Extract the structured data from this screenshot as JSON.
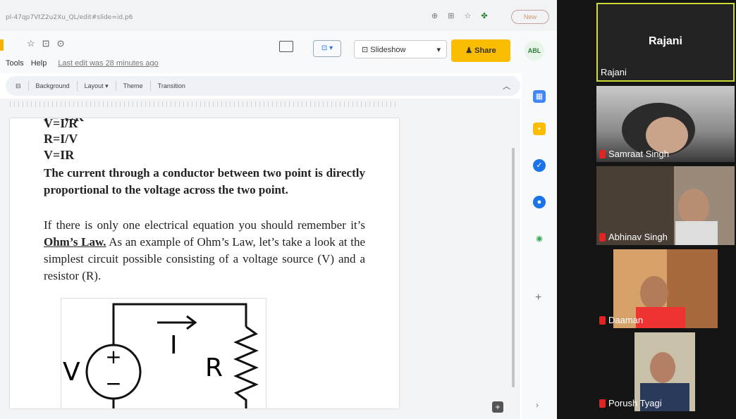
{
  "browser": {
    "url": "pl-47qp7VtZ2u2Xu_QL/edit#slide=id.p6",
    "new_label": "New",
    "docs_menu": [
      "Tools",
      "Help"
    ],
    "last_edit": "Last edit was 28 minutes ago",
    "slideshow_label": "Slideshow",
    "share_label": "Share",
    "avatar_label": "ABL",
    "toolbar": [
      "Background",
      "Layout ▾",
      "Theme",
      "Transition"
    ],
    "accent_color": "#fbbc04"
  },
  "slide": {
    "line0": "I = V/R",
    "line1": "V=I/R",
    "line2": "R=I/V",
    "line3": "V=IR",
    "law_statement": "The current through a conductor between two point is directly proportional to the voltage across the two point.",
    "para_before": "If there is only one electrical equation you should remember it’s ",
    "law_name": "Ohm’s Law.",
    "para_after": " As an example of Ohm’s Law, let’s take a look at the simplest circuit possible consisting of a voltage source (V) and a resistor (R).",
    "circuit": {
      "voltage": "V",
      "current": "I",
      "resistor": "R"
    }
  },
  "participants": [
    {
      "name": "Rajani",
      "mic_muted": false,
      "active": true
    },
    {
      "name": "Samraat Singh",
      "mic_muted": true
    },
    {
      "name": "Abhinav Singh",
      "mic_muted": true
    },
    {
      "name": "Daaman",
      "mic_muted": true
    },
    {
      "name": "Porush Tyagi",
      "mic_muted": true
    }
  ]
}
